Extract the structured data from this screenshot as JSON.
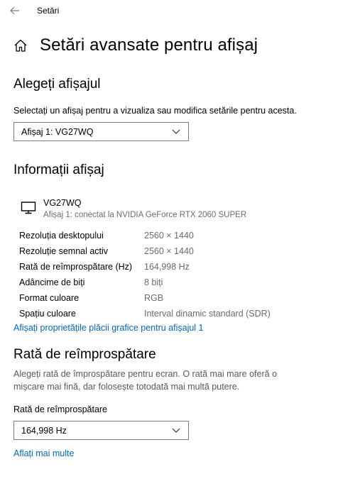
{
  "window": {
    "title": "Setări"
  },
  "page": {
    "title": "Setări avansate pentru afișaj"
  },
  "choose_display": {
    "heading": "Alegeți afișajul",
    "description": "Selectați un afișaj pentru a vizualiza sau modifica setările pentru acesta.",
    "selected": "Afișaj 1: VG27WQ"
  },
  "display_info": {
    "heading": "Informații afișaj",
    "monitor_name": "VG27WQ",
    "monitor_sub": "Afișaj 1: conectat la NVIDIA GeForce RTX 2060 SUPER",
    "rows": [
      {
        "label": "Rezoluția desktopului",
        "value": "2560 × 1440"
      },
      {
        "label": "Rezoluție semnal activ",
        "value": "2560 × 1440"
      },
      {
        "label": "Rată de reîmprospătare (Hz)",
        "value": "164,998 Hz"
      },
      {
        "label": "Adâncime de biți",
        "value": "8 biți"
      },
      {
        "label": "Format culoare",
        "value": "RGB"
      },
      {
        "label": "Spațiu culoare",
        "value": "Interval dinamic standard (SDR)"
      }
    ],
    "adapter_link": "Afișați proprietățile plăcii grafice pentru afișajul 1"
  },
  "refresh_rate": {
    "heading": "Rată de reîmprospătare",
    "description_line1": "Alegeți rată de împrospătare pentru ecran. O rată mai mare oferă o",
    "description_line2": "mișcare mai fină, dar folosește totodată mai multă putere.",
    "field_label": "Rată de reîmprospătare",
    "selected": "164,998 Hz",
    "learn_more": "Aflați mai multe"
  },
  "colors": {
    "accent": "#0067c0",
    "muted": "#6b6b6b",
    "border": "#7a7a7a"
  }
}
